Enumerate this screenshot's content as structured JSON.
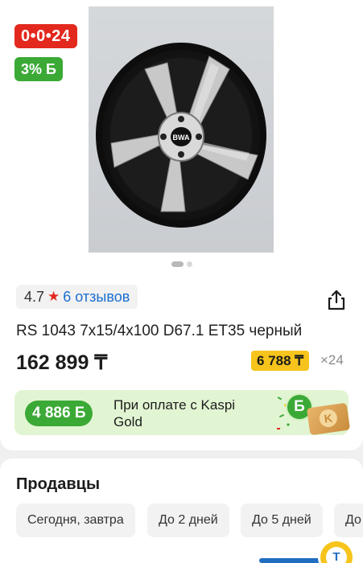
{
  "badges": {
    "installment": "0•0•24",
    "bonus": "3% Б"
  },
  "rating": {
    "value": "4.7",
    "star_icon": "star-icon",
    "reviews": "6 отзывов"
  },
  "product": {
    "title": "RS 1043 7x15/4x100 D67.1 ET35 черный",
    "price": "162 899 ₸",
    "monthly_price": "6 788 ₸",
    "monthly_count": "×24"
  },
  "kaspi": {
    "amount": "4 886 Б",
    "text": "При оплате с Kaspi Gold",
    "bonus_symbol": "Б",
    "gold_card_symbol": "K"
  },
  "sellers": {
    "title": "Продавцы",
    "filters": [
      "Сегодня, завтра",
      "До 2 дней",
      "До 5 дней",
      "До"
    ]
  },
  "chat": {
    "symbol": "T"
  },
  "colors": {
    "red": "#e3281e",
    "green": "#3ba936",
    "yellow": "#f6c41b",
    "blue": "#1a6fd0"
  }
}
